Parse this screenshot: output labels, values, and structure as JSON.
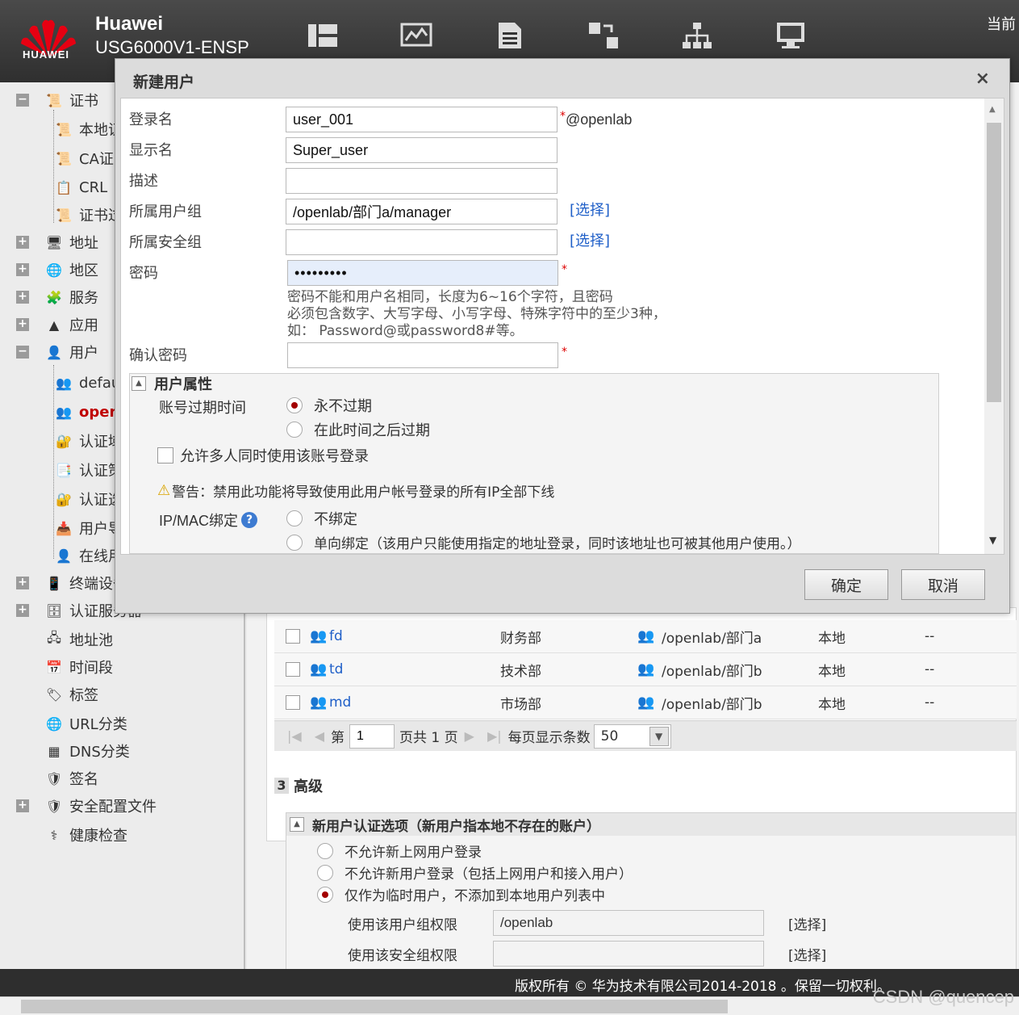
{
  "header": {
    "brand": "Huawei",
    "model": "USG6000V1-ENSP",
    "logo_text": "HUAWEI",
    "top_right": "当前",
    "nav_icons": [
      "dashboard-icon",
      "monitor-icon",
      "policy-icon",
      "object-icon",
      "network-icon",
      "system-icon"
    ]
  },
  "sidebar": {
    "items": [
      {
        "label": "证书",
        "expander": "−"
      },
      {
        "label": "本地证"
      },
      {
        "label": "CA证"
      },
      {
        "label": "CRL"
      },
      {
        "label": "证书过"
      },
      {
        "label": "地址",
        "expander": "+"
      },
      {
        "label": "地区",
        "expander": "+"
      },
      {
        "label": "服务",
        "expander": "+"
      },
      {
        "label": "应用",
        "expander": "+"
      },
      {
        "label": "用户",
        "expander": "−"
      },
      {
        "label": "defau"
      },
      {
        "label": "openl"
      },
      {
        "label": "认证域"
      },
      {
        "label": "认证策"
      },
      {
        "label": "认证选"
      },
      {
        "label": "用户导"
      },
      {
        "label": "在线用"
      },
      {
        "label": "终端设备",
        "expander": "+"
      },
      {
        "label": "认证服务器",
        "expander": "+"
      },
      {
        "label": "地址池"
      },
      {
        "label": "时间段"
      },
      {
        "label": "标签"
      },
      {
        "label": "URL分类"
      },
      {
        "label": "DNS分类"
      },
      {
        "label": "签名"
      },
      {
        "label": "安全配置文件",
        "expander": "+"
      },
      {
        "label": "健康检查"
      }
    ]
  },
  "users_table": {
    "rows": [
      {
        "name": "fd",
        "desc": "财务部",
        "group": "/openlab/部门a",
        "source": "本地",
        "extra": "--"
      },
      {
        "name": "td",
        "desc": "技术部",
        "group": "/openlab/部门b",
        "source": "本地",
        "extra": "--"
      },
      {
        "name": "md",
        "desc": "市场部",
        "group": "/openlab/部门b",
        "source": "本地",
        "extra": "--"
      }
    ],
    "pager": {
      "page_prefix": "第",
      "page_value": "1",
      "page_suffix": "页共 1 页",
      "per_page_label": "每页显示条数",
      "per_page_value": "50"
    }
  },
  "advanced": {
    "number": "3",
    "title": "高级",
    "group_title": "新用户认证选项（新用户指本地不存在的账户）",
    "options": [
      {
        "label": "不允许新上网用户登录",
        "selected": false
      },
      {
        "label": "不允许新用户登录（包括上网用户和接入用户）",
        "selected": false
      },
      {
        "label": "仅作为临时用户，不添加到本地用户列表中",
        "selected": true
      }
    ],
    "user_group_label": "使用该用户组权限",
    "user_group_value": "/openlab",
    "security_group_label": "使用该安全组权限",
    "security_group_value": "",
    "select_link": "[选择]"
  },
  "footer": {
    "copyright": "版权所有 © 华为技术有限公司2014-2018 。保留一切权利。",
    "watermark": "CSDN @quencep"
  },
  "dialog": {
    "title": "新建用户",
    "close": "×",
    "login_name_label": "登录名",
    "login_name_value": "user_001",
    "login_suffix": "@openlab",
    "display_name_label": "显示名",
    "display_name_value": "Super_user",
    "description_label": "描述",
    "description_value": "",
    "user_group_label": "所属用户组",
    "user_group_value": "/openlab/部门a/manager",
    "security_group_label": "所属安全组",
    "security_group_value": "",
    "select_link": "[选择]",
    "password_label": "密码",
    "password_value": "•••••••••",
    "password_hint_1": "密码不能和用户名相同，长度为6~16个字符，且密码",
    "password_hint_2": "必须包含数字、大写字母、小写字母、特殊字符中的至少3种，",
    "password_hint_3": "如： Password@或password8#等。",
    "confirm_password_label": "确认密码",
    "confirm_password_value": "",
    "required_mark": "*",
    "props_title": "用户属性",
    "expiry_label": "账号过期时间",
    "expiry_never": "永不过期",
    "expiry_after": "在此时间之后过期",
    "multi_login_label": "允许多人同时使用该账号登录",
    "warning_text": "警告：禁用此功能将导致使用此用户帐号登录的所有IP全部下线",
    "ipmac_label": "IP/MAC绑定",
    "bind_none": "不绑定",
    "bind_one_way": "单向绑定（该用户只能使用指定的地址登录，同时该地址也可被其他用户使用。）",
    "ok_button": "确定",
    "cancel_button": "取消"
  }
}
